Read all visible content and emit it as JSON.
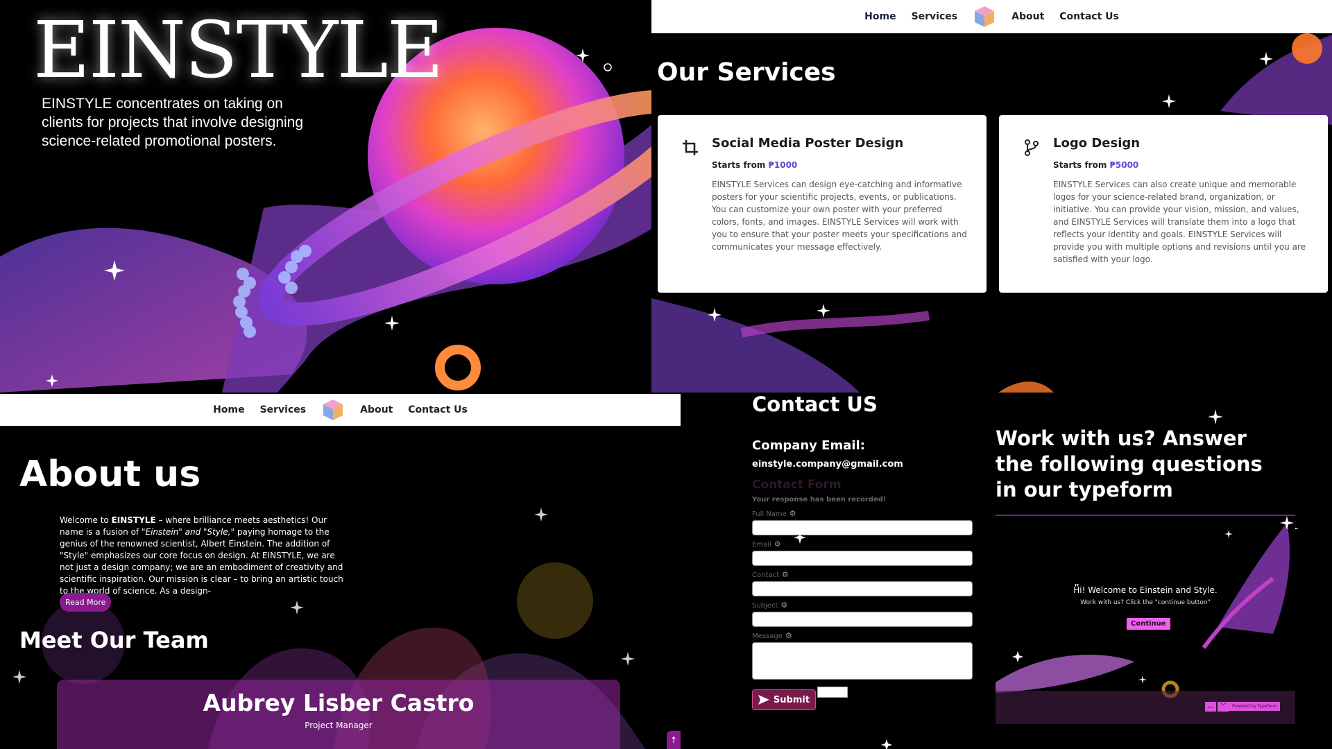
{
  "hero": {
    "title": "EINSTYLE",
    "subtitle": "EINSTYLE concentrates on taking on clients for projects that involve designing science-related promotional posters."
  },
  "nav": {
    "items": [
      "Home",
      "Services",
      "About",
      "Contact Us"
    ],
    "logo_icon": "cube-logo-icon"
  },
  "services": {
    "title": "Our Services",
    "cards": [
      {
        "icon": "crop-icon",
        "title": "Social Media Poster Design",
        "price_prefix": "Starts from",
        "price": "₱1000",
        "description": "EINSTYLE Services can design eye-catching and informative posters for your scientific projects, events, or publications. You can customize your own poster with your preferred colors, fonts, and images. EINSTYLE Services will work with you to ensure that your poster meets your specifications and communicates your message effectively."
      },
      {
        "icon": "git-branch-icon",
        "title": "Logo Design",
        "price_prefix": "Starts from",
        "price": "₱5000",
        "description": "EINSTYLE Services can also create unique and memorable logos for your science-related brand, organization, or initiative. You can provide your vision, mission, and values, and EINSTYLE Services will translate them into a logo that reflects your identity and goals. EINSTYLE Services will provide you with multiple options and revisions until you are satisfied with your logo."
      }
    ]
  },
  "about": {
    "title": "About us",
    "text_1": "Welcome to ",
    "text_brand": "EINSTYLE",
    "text_2": " – where brilliance meets aesthetics! Our name is a fusion of ",
    "text_italic": "\"Einstein\" and \"Style,\"",
    "text_3": " paying homage to the genius of the renowned scientist, Albert Einstein. The addition of \"Style\" emphasizes our core focus on design. At EINSTYLE, we are not just a design company; we are an embodiment of creativity and scientific inspiration. Our mission is clear – to bring an artistic touch to the world of science. As a design-",
    "read_more": "Read More",
    "team_title": "Meet Our Team",
    "member_name": "Aubrey Lisber Castro",
    "member_role": "Project Manager",
    "scroll_top": "↑"
  },
  "contact": {
    "title": "Contact US",
    "company_label": "Company Email:",
    "company_email": "einstyle.company@gmail.com",
    "form_title": "Contact Form",
    "form_status": "Your response has been recorded!",
    "fields": [
      "Full Name",
      "Email",
      "Contact",
      "Subject",
      "Message"
    ],
    "submit": "Submit",
    "work_title": "Work with us? Answer the following questions in our typeform",
    "typeform": {
      "quote": "”",
      "hi": "Hi! Welcome to Einstein and Style.",
      "sub": "Work with us? Click the \"continue button\"",
      "continue": "Continue",
      "up": "︿",
      "down": "﹀",
      "powered": "Powered by Typeform"
    }
  },
  "colors": {
    "accent": "#8a1a8f",
    "price": "#5b4bd6",
    "typeform_button": "#f25ff2"
  }
}
